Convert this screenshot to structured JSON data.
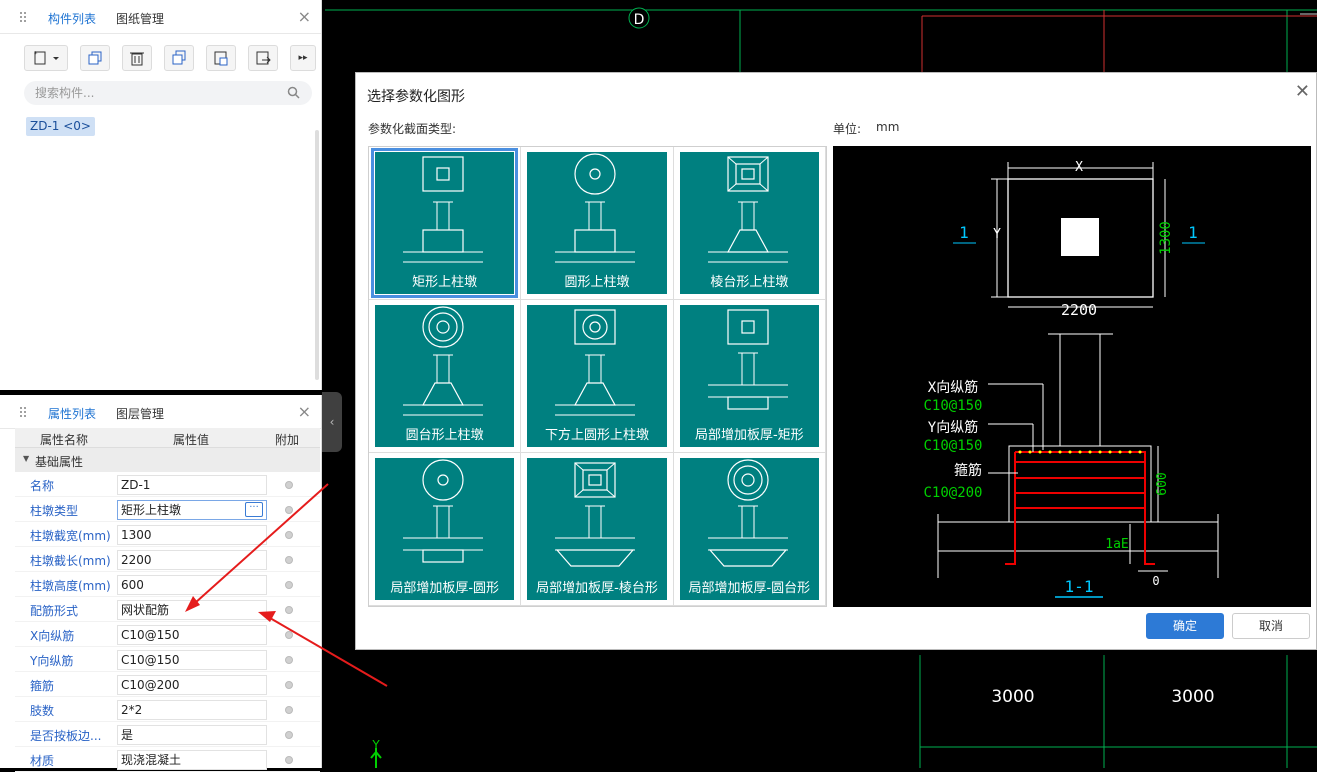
{
  "cad": {
    "axis_label": "D",
    "dims": [
      "3000",
      "3000"
    ],
    "y_axis": "Y"
  },
  "component_panel": {
    "tabs": [
      "构件列表",
      "图纸管理"
    ],
    "search_placeholder": "搜索构件...",
    "selected_component": "ZD-1 <0>"
  },
  "property_panel": {
    "tabs": [
      "属性列表",
      "图层管理"
    ],
    "headers": [
      "属性名称",
      "属性值",
      "附加"
    ],
    "group": "基础属性",
    "rows": [
      {
        "name": "名称",
        "value": "ZD-1"
      },
      {
        "name": "柱墩类型",
        "value": "矩形上柱墩"
      },
      {
        "name": "柱墩截宽(mm)",
        "value": "1300"
      },
      {
        "name": "柱墩截长(mm)",
        "value": "2200"
      },
      {
        "name": "柱墩高度(mm)",
        "value": "600"
      },
      {
        "name": "配筋形式",
        "value": "网状配筋"
      },
      {
        "name": "X向纵筋",
        "value": "C10@150"
      },
      {
        "name": "Y向纵筋",
        "value": "C10@150"
      },
      {
        "name": "箍筋",
        "value": "C10@200"
      },
      {
        "name": "肢数",
        "value": "2*2"
      },
      {
        "name": "是否按板边...",
        "value": "是"
      },
      {
        "name": "材质",
        "value": "现浇混凝土"
      }
    ],
    "ellipsis": "···"
  },
  "dialog": {
    "title": "选择参数化图形",
    "section_label": "参数化截面类型:",
    "unit_label": "单位:",
    "unit_value": "mm",
    "shapes": [
      "矩形上柱墩",
      "圆形上柱墩",
      "棱台形上柱墩",
      "圆台形上柱墩",
      "下方上圆形上柱墩",
      "局部增加板厚-矩形",
      "局部增加板厚-圆形",
      "局部增加板厚-棱台形",
      "局部增加板厚-圆台形"
    ],
    "preview": {
      "x": "X",
      "y": "Y",
      "width": "2200",
      "height": "1300",
      "section_mark": "1",
      "x_rebar_label": "X向纵筋",
      "x_rebar": "C10@150",
      "y_rebar_label": "Y向纵筋",
      "y_rebar": "C10@150",
      "stirrup_label": "箍筋",
      "stirrup": "C10@200",
      "depth": "600",
      "anchor": "1aE",
      "zero": "0",
      "section_title": "1-1"
    },
    "ok": "确定",
    "cancel": "取消"
  }
}
